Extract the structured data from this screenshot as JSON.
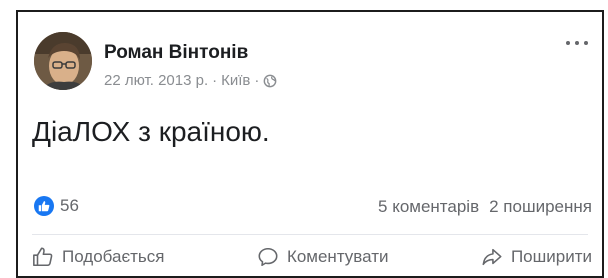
{
  "post": {
    "author": "Роман Вінтонів",
    "date": "22 лют. 2013 р.",
    "separator1": "·",
    "location": "Київ",
    "separator2": "·",
    "audience_icon": "globe-icon",
    "text": "ДіаЛОХ з країною.",
    "menu_icon": "more-options-icon"
  },
  "engagement": {
    "reaction_icon": "like-reaction-icon",
    "reaction_color": "#1877f2",
    "reactions_count": "56",
    "comments": "5 коментарів",
    "shares": "2 поширення"
  },
  "actions": {
    "like_label": "Подобається",
    "like_icon": "thumbs-up-icon",
    "comment_label": "Коментувати",
    "comment_icon": "comment-bubble-icon",
    "share_label": "Поширити",
    "share_icon": "share-arrow-icon"
  },
  "colors": {
    "text_primary": "#1c1e21",
    "text_secondary": "#65676b",
    "meta_text": "#8a8d91",
    "accent": "#1877f2"
  }
}
